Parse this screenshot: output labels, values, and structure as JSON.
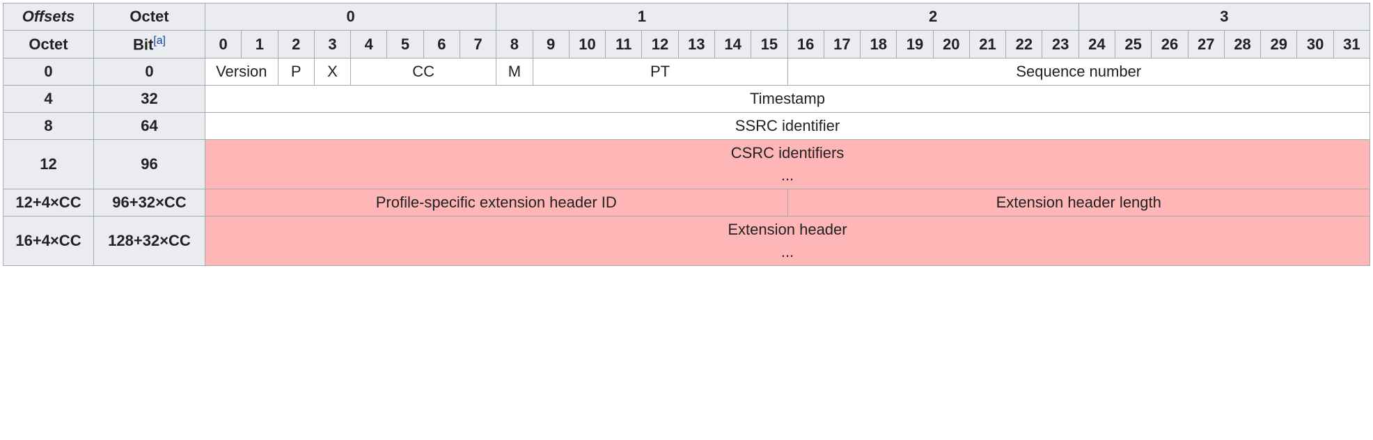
{
  "header": {
    "offsets": "Offsets",
    "octet": "Octet",
    "bit": "Bit",
    "footnote_ref": "[a]",
    "octet_cols": [
      "0",
      "1",
      "2",
      "3"
    ],
    "bit_cols": [
      "0",
      "1",
      "2",
      "3",
      "4",
      "5",
      "6",
      "7",
      "8",
      "9",
      "10",
      "11",
      "12",
      "13",
      "14",
      "15",
      "16",
      "17",
      "18",
      "19",
      "20",
      "21",
      "22",
      "23",
      "24",
      "25",
      "26",
      "27",
      "28",
      "29",
      "30",
      "31"
    ]
  },
  "rows": [
    {
      "octet": "0",
      "bit": "0",
      "cells": [
        {
          "label": "Version",
          "span": 2,
          "optional": false
        },
        {
          "label": "P",
          "span": 1,
          "optional": false
        },
        {
          "label": "X",
          "span": 1,
          "optional": false
        },
        {
          "label": "CC",
          "span": 4,
          "optional": false
        },
        {
          "label": "M",
          "span": 1,
          "optional": false
        },
        {
          "label": "PT",
          "span": 7,
          "optional": false
        },
        {
          "label": "Sequence number",
          "span": 16,
          "optional": false
        }
      ]
    },
    {
      "octet": "4",
      "bit": "32",
      "cells": [
        {
          "label": "Timestamp",
          "span": 32,
          "optional": false
        }
      ]
    },
    {
      "octet": "8",
      "bit": "64",
      "cells": [
        {
          "label": "SSRC identifier",
          "span": 32,
          "optional": false
        }
      ]
    },
    {
      "octet": "12",
      "bit": "96",
      "cells": [
        {
          "label": "CSRC identifiers",
          "label2": "...",
          "span": 32,
          "optional": true
        }
      ]
    },
    {
      "octet": "12+4×CC",
      "bit": "96+32×CC",
      "cells": [
        {
          "label": "Profile-specific extension header ID",
          "span": 16,
          "optional": true
        },
        {
          "label": "Extension header length",
          "span": 16,
          "optional": true
        }
      ]
    },
    {
      "octet": "16+4×CC",
      "bit": "128+32×CC",
      "cells": [
        {
          "label": "Extension header",
          "label2": "...",
          "span": 32,
          "optional": true
        }
      ]
    }
  ]
}
